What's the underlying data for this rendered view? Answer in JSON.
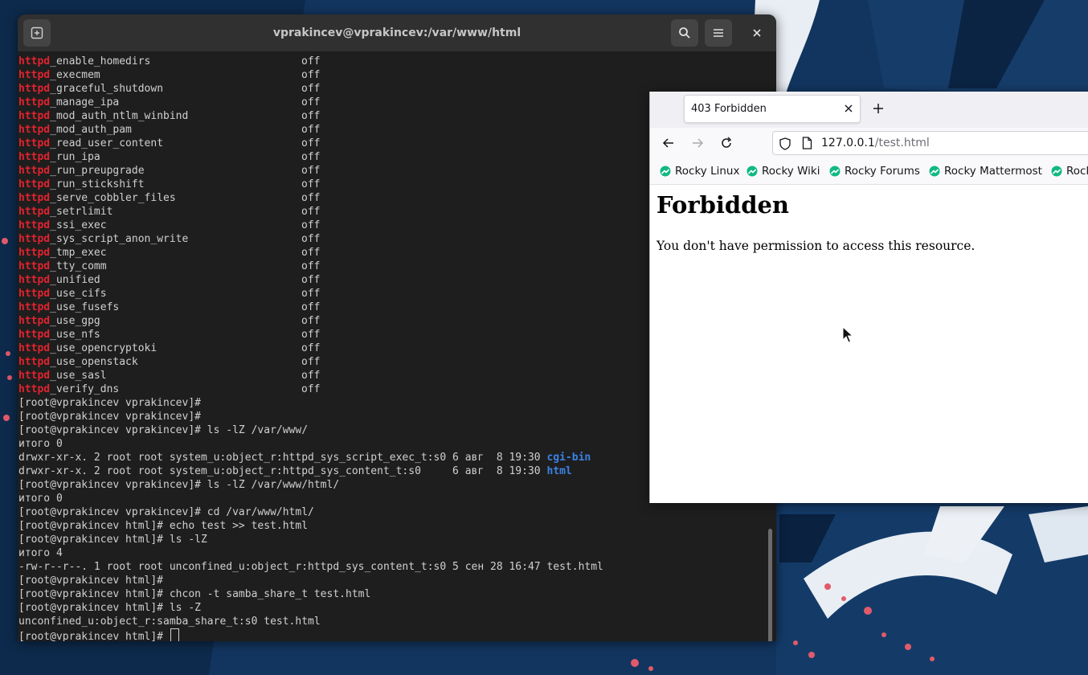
{
  "terminal": {
    "title": "vprakincev@vprakincev:/var/www/html",
    "booleans": [
      {
        "prefix": "httpd",
        "suffix": "_enable_homedirs",
        "value": "off"
      },
      {
        "prefix": "httpd",
        "suffix": "_execmem",
        "value": "off"
      },
      {
        "prefix": "httpd",
        "suffix": "_graceful_shutdown",
        "value": "off"
      },
      {
        "prefix": "httpd",
        "suffix": "_manage_ipa",
        "value": "off"
      },
      {
        "prefix": "httpd",
        "suffix": "_mod_auth_ntlm_winbind",
        "value": "off"
      },
      {
        "prefix": "httpd",
        "suffix": "_mod_auth_pam",
        "value": "off"
      },
      {
        "prefix": "httpd",
        "suffix": "_read_user_content",
        "value": "off"
      },
      {
        "prefix": "httpd",
        "suffix": "_run_ipa",
        "value": "off"
      },
      {
        "prefix": "httpd",
        "suffix": "_run_preupgrade",
        "value": "off"
      },
      {
        "prefix": "httpd",
        "suffix": "_run_stickshift",
        "value": "off"
      },
      {
        "prefix": "httpd",
        "suffix": "_serve_cobbler_files",
        "value": "off"
      },
      {
        "prefix": "httpd",
        "suffix": "_setrlimit",
        "value": "off"
      },
      {
        "prefix": "httpd",
        "suffix": "_ssi_exec",
        "value": "off"
      },
      {
        "prefix": "httpd",
        "suffix": "_sys_script_anon_write",
        "value": "off"
      },
      {
        "prefix": "httpd",
        "suffix": "_tmp_exec",
        "value": "off"
      },
      {
        "prefix": "httpd",
        "suffix": "_tty_comm",
        "value": "off"
      },
      {
        "prefix": "httpd",
        "suffix": "_unified",
        "value": "off"
      },
      {
        "prefix": "httpd",
        "suffix": "_use_cifs",
        "value": "off"
      },
      {
        "prefix": "httpd",
        "suffix": "_use_fusefs",
        "value": "off"
      },
      {
        "prefix": "httpd",
        "suffix": "_use_gpg",
        "value": "off"
      },
      {
        "prefix": "httpd",
        "suffix": "_use_nfs",
        "value": "off"
      },
      {
        "prefix": "httpd",
        "suffix": "_use_opencryptoki",
        "value": "off"
      },
      {
        "prefix": "httpd",
        "suffix": "_use_openstack",
        "value": "off"
      },
      {
        "prefix": "httpd",
        "suffix": "_use_sasl",
        "value": "off"
      },
      {
        "prefix": "httpd",
        "suffix": "_verify_dns",
        "value": "off"
      }
    ],
    "lines": {
      "l1": "[root@vprakincev vprakincev]#",
      "l2": "[root@vprakincev vprakincev]#",
      "l3": "[root@vprakincev vprakincev]# ls -lZ /var/www/",
      "l4": "итого 0",
      "l5_text": "drwxr-xr-x. 2 root root system_u:object_r:httpd_sys_script_exec_t:s0 6 авг  8 19:30 ",
      "l5_dir": "cgi-bin",
      "l6_text": "drwxr-xr-x. 2 root root system_u:object_r:httpd_sys_content_t:s0     6 авг  8 19:30 ",
      "l6_dir": "html",
      "l7": "[root@vprakincev vprakincev]# ls -lZ /var/www/html/",
      "l8": "итого 0",
      "l9": "[root@vprakincev vprakincev]# cd /var/www/html/",
      "l10": "[root@vprakincev html]# echo test >> test.html",
      "l11": "[root@vprakincev html]# ls -lZ",
      "l12": "итого 4",
      "l13": "-rw-r--r--. 1 root root unconfined_u:object_r:httpd_sys_content_t:s0 5 сен 28 16:47 test.html",
      "l14": "[root@vprakincev html]#",
      "l15": "[root@vprakincev html]# chcon -t samba_share_t test.html",
      "l16": "[root@vprakincev html]# ls -Z",
      "l17": "unconfined_u:object_r:samba_share_t:s0 test.html",
      "l18": "[root@vprakincev html]# "
    }
  },
  "browser": {
    "tab_title": "403 Forbidden",
    "url_host": "127.0.0.1",
    "url_path": "/test.html",
    "bookmarks": [
      "Rocky Linux",
      "Rocky Wiki",
      "Rocky Forums",
      "Rocky Mattermost",
      "Rock"
    ],
    "page": {
      "heading": "Forbidden",
      "message": "You don't have permission to access this resource."
    }
  },
  "colors": {
    "terminal_bg": "#1e1e1e",
    "keyword_red": "#e0232f",
    "dir_blue": "#3b82e2",
    "rocky_green": "#10b981"
  }
}
